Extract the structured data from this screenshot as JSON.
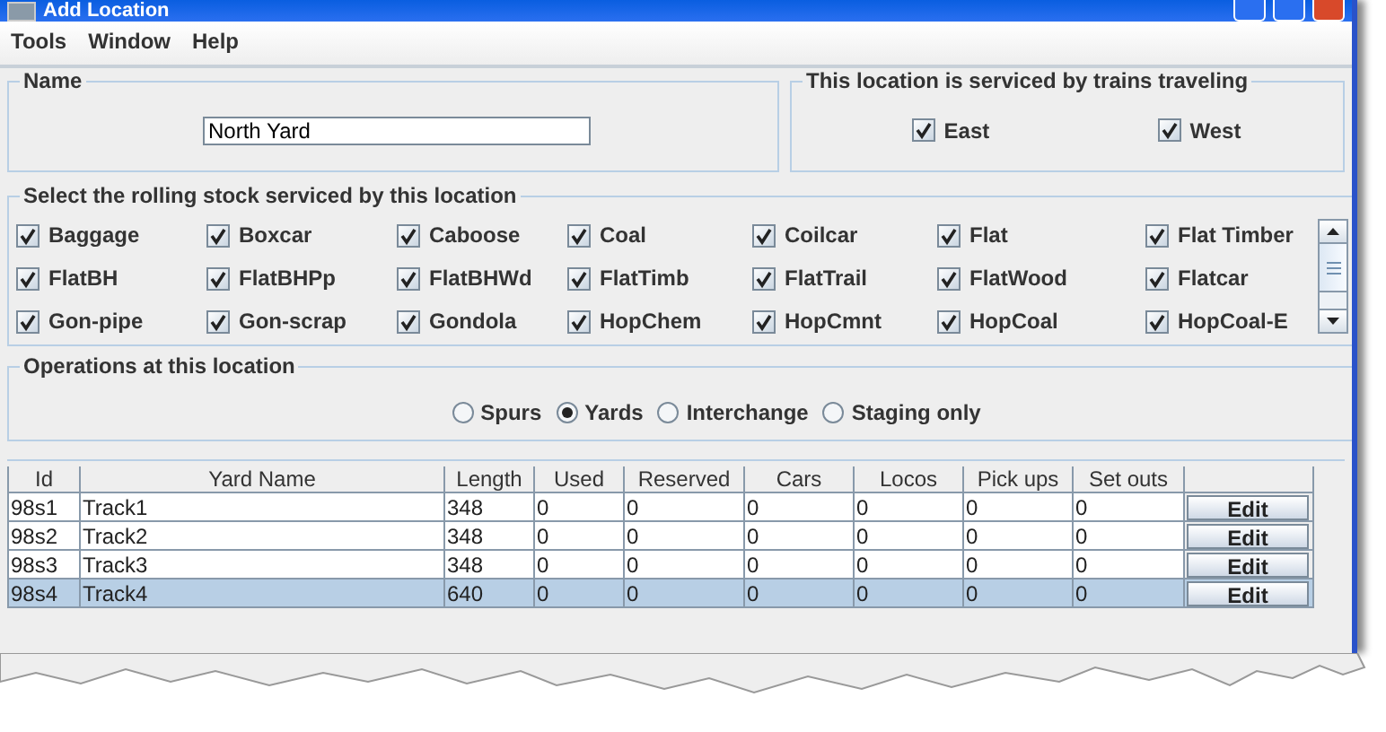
{
  "window": {
    "title": "Add Location"
  },
  "menu": [
    {
      "label": "Tools"
    },
    {
      "label": "Window"
    },
    {
      "label": "Help"
    }
  ],
  "name_group": {
    "legend": "Name",
    "value": "North Yard"
  },
  "direction_group": {
    "legend": "This location is serviced by trains traveling",
    "options": [
      {
        "label": "East",
        "checked": true
      },
      {
        "label": "West",
        "checked": true
      }
    ]
  },
  "rolling_stock": {
    "legend": "Select the rolling stock serviced by this location",
    "items": [
      {
        "label": "Baggage",
        "checked": true
      },
      {
        "label": "Boxcar",
        "checked": true
      },
      {
        "label": "Caboose",
        "checked": true
      },
      {
        "label": "Coal",
        "checked": true
      },
      {
        "label": "Coilcar",
        "checked": true
      },
      {
        "label": "Flat",
        "checked": true
      },
      {
        "label": "Flat Timber",
        "checked": true
      },
      {
        "label": "FlatBH",
        "checked": true
      },
      {
        "label": "FlatBHPp",
        "checked": true
      },
      {
        "label": "FlatBHWd",
        "checked": true
      },
      {
        "label": "FlatTimb",
        "checked": true
      },
      {
        "label": "FlatTrail",
        "checked": true
      },
      {
        "label": "FlatWood",
        "checked": true
      },
      {
        "label": "Flatcar",
        "checked": true
      },
      {
        "label": "Gon-pipe",
        "checked": true
      },
      {
        "label": "Gon-scrap",
        "checked": true
      },
      {
        "label": "Gondola",
        "checked": true
      },
      {
        "label": "HopChem",
        "checked": true
      },
      {
        "label": "HopCmnt",
        "checked": true
      },
      {
        "label": "HopCoal",
        "checked": true
      },
      {
        "label": "HopCoal-E",
        "checked": true
      }
    ]
  },
  "operations": {
    "legend": "Operations at this location",
    "options": [
      {
        "label": "Spurs",
        "selected": false
      },
      {
        "label": "Yards",
        "selected": true
      },
      {
        "label": "Interchange",
        "selected": false
      },
      {
        "label": "Staging only",
        "selected": false
      }
    ]
  },
  "table": {
    "columns": [
      "Id",
      "Yard Name",
      "Length",
      "Used",
      "Reserved",
      "Cars",
      "Locos",
      "Pick ups",
      "Set outs"
    ],
    "rows": [
      {
        "cells": [
          "98s1",
          "Track1",
          "348",
          "0",
          "0",
          "0",
          "0",
          "0",
          "0"
        ],
        "button": "Edit",
        "selected": false
      },
      {
        "cells": [
          "98s2",
          "Track2",
          "348",
          "0",
          "0",
          "0",
          "0",
          "0",
          "0"
        ],
        "button": "Edit",
        "selected": false
      },
      {
        "cells": [
          "98s3",
          "Track3",
          "348",
          "0",
          "0",
          "0",
          "0",
          "0",
          "0"
        ],
        "button": "Edit",
        "selected": false
      },
      {
        "cells": [
          "98s4",
          "Track4",
          "640",
          "0",
          "0",
          "0",
          "0",
          "0",
          "0"
        ],
        "button": "Edit",
        "selected": true
      }
    ]
  }
}
